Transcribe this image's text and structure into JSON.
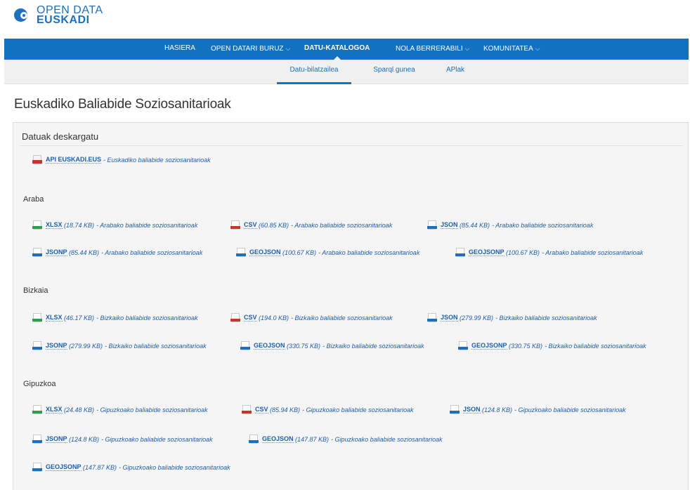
{
  "logo": {
    "line1": "OPEN DATA",
    "line2": "EUSKADI"
  },
  "topnav": [
    {
      "label": "HASIERA",
      "dropdown": false,
      "active": false
    },
    {
      "label": "OPEN DATARI BURUZ",
      "dropdown": true,
      "active": false
    },
    {
      "label": "DATU-KATALOGOA",
      "dropdown": false,
      "active": true
    },
    {
      "label": "NOLA BERRERABILI",
      "dropdown": true,
      "active": false
    },
    {
      "label": "KOMUNITATEA",
      "dropdown": true,
      "active": false
    }
  ],
  "subnav": [
    {
      "label": "Datu-bilatzailea",
      "active": true
    },
    {
      "label": "Sparql gunea",
      "active": false
    },
    {
      "label": "APlak",
      "active": false
    }
  ],
  "page_title": "Euskadiko Baliabide Soziosanitarioak",
  "panel_heading": "Datuak deskargatu",
  "api_link": {
    "format": "API EUSKADI.EUS",
    "desc": "- Euskadiko baliabide soziosanitarioak"
  },
  "sections": [
    {
      "title": "Araba",
      "items": [
        {
          "icon": "xlsx",
          "format": "XLSX",
          "size": "(18.74 KB)",
          "desc": "- Arabako baliabide soziosanitarioak"
        },
        {
          "icon": "csv",
          "format": "CSV",
          "size": "(60.85 KB)",
          "desc": "- Arabako baliabide soziosanitarioak"
        },
        {
          "icon": "json",
          "format": "JSON",
          "size": "(85.44 KB)",
          "desc": "- Arabako baliabide soziosanitarioak"
        },
        {
          "icon": "json",
          "format": "JSONP",
          "size": "(85.44 KB)",
          "desc": "- Arabako baliabide soziosanitarioak"
        },
        {
          "icon": "json",
          "format": "GEOJSON",
          "size": "(100.67 KB)",
          "desc": "- Arabako baliabide soziosanitarioak"
        },
        {
          "icon": "json",
          "format": "GEOJSONP",
          "size": "(100.67 KB)",
          "desc": "- Arabako baliabide soziosanitarioak"
        }
      ]
    },
    {
      "title": "Bizkaia",
      "items": [
        {
          "icon": "xlsx",
          "format": "XLSX",
          "size": "(46.17 KB)",
          "desc": "- Bizkaiko baliabide soziosanitarioak"
        },
        {
          "icon": "csv",
          "format": "CSV",
          "size": "(194.0 KB)",
          "desc": "- Bizkaiko baliabide soziosanitarioak"
        },
        {
          "icon": "json",
          "format": "JSON",
          "size": "(279.99 KB)",
          "desc": "- Bizkaiko baliabide soziosanitarioak"
        },
        {
          "icon": "json",
          "format": "JSONP",
          "size": "(279.99 KB)",
          "desc": "- Bizkaiko baliabide soziosanitarioak"
        },
        {
          "icon": "json",
          "format": "GEOJSON",
          "size": "(330.75 KB)",
          "desc": "- Bizkaiko baliabide soziosanitarioak"
        },
        {
          "icon": "json",
          "format": "GEOJSONP",
          "size": "(330.75 KB)",
          "desc": "- Bizkaiko baliabide soziosanitarioak"
        }
      ]
    },
    {
      "title": "Gipuzkoa",
      "items": [
        {
          "icon": "xlsx",
          "format": "XLSX",
          "size": "(24.48 KB)",
          "desc": "- Gipuzkoako baliabide soziosanitarioak"
        },
        {
          "icon": "csv",
          "format": "CSV",
          "size": "(85.94 KB)",
          "desc": "- Gipuzkoako baliabide soziosanitarioak"
        },
        {
          "icon": "json",
          "format": "JSON",
          "size": "(124.8 KB)",
          "desc": "- Gipuzkoako baliabide soziosanitarioak"
        },
        {
          "icon": "json",
          "format": "JSONP",
          "size": "(124.8 KB)",
          "desc": "- Gipuzkoako baliabide soziosanitarioak"
        },
        {
          "icon": "json",
          "format": "GEOJSON",
          "size": "(147.87 KB)",
          "desc": "- Gipuzkoako baliabide soziosanitarioak"
        },
        {
          "icon": "json",
          "format": "GEOJSONP",
          "size": "(147.87 KB)",
          "desc": "- Gipuzkoako baliabide soziosanitarioak"
        }
      ]
    }
  ]
}
